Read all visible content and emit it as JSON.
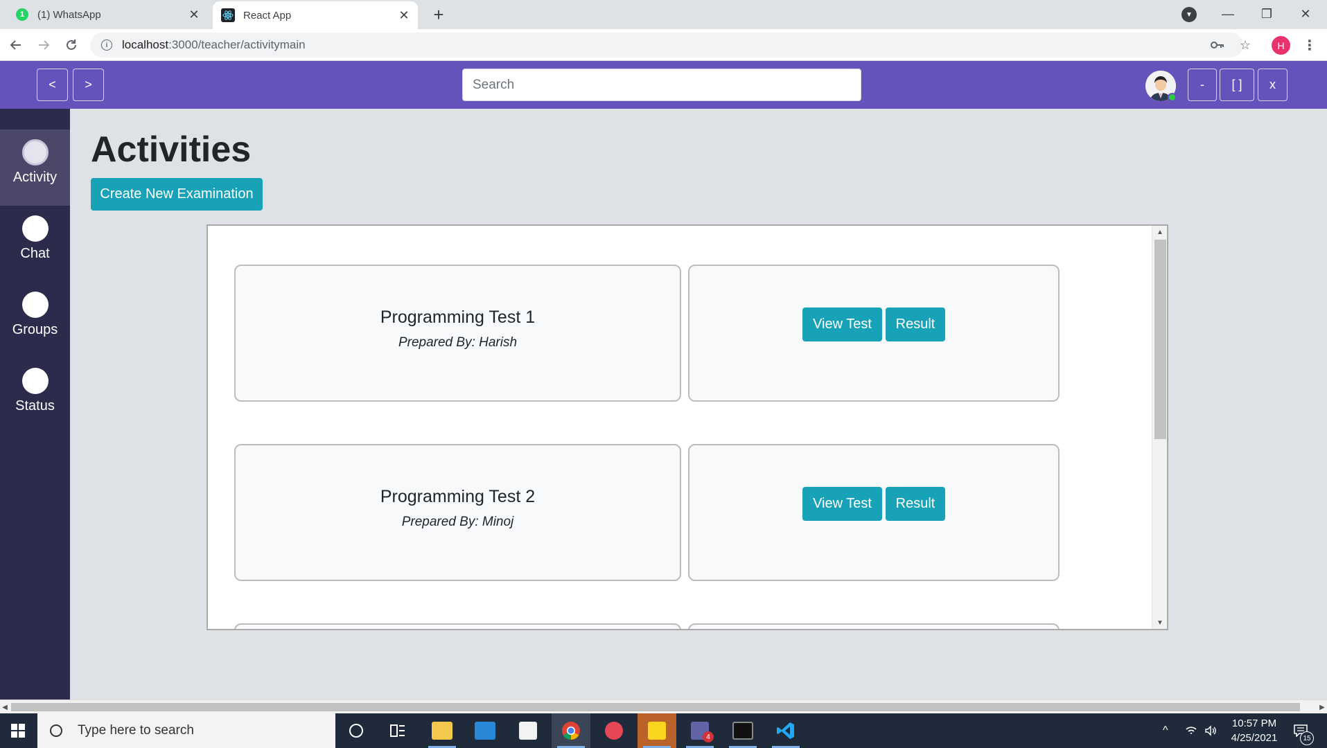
{
  "browser": {
    "tabs": [
      {
        "title": "(1) WhatsApp",
        "badge": "1"
      },
      {
        "title": "React App"
      }
    ],
    "new_tab_label": "+",
    "url_host": "localhost",
    "url_path": ":3000/teacher/activitymain",
    "profile_initial": "H",
    "window_controls": {
      "minimize": "—",
      "restore": "❐",
      "close": "✕"
    }
  },
  "header": {
    "back_label": "<",
    "forward_label": ">",
    "search_placeholder": "Search",
    "minimize_label": "-",
    "maximize_label": "[ ]",
    "close_label": "x"
  },
  "sidebar": {
    "items": [
      {
        "label": "Activity",
        "active": true
      },
      {
        "label": "Chat"
      },
      {
        "label": "Groups"
      },
      {
        "label": "Status"
      }
    ]
  },
  "main": {
    "title": "Activities",
    "create_button": "Create New Examination",
    "activities": [
      {
        "name": "Programming Test 1",
        "prepared_by": "Prepared By: Harish",
        "view_label": "View Test",
        "result_label": "Result"
      },
      {
        "name": "Programming Test 2",
        "prepared_by": "Prepared By: Minoj",
        "view_label": "View Test",
        "result_label": "Result"
      }
    ]
  },
  "taskbar": {
    "search_placeholder": "Type here to search",
    "time": "10:57 PM",
    "date": "4/25/2021",
    "teams_badge": "4",
    "notification_count": "15"
  },
  "colors": {
    "header_bg": "#6652bb",
    "sidebar_bg": "#2d2b4b",
    "accent_teal": "#17a2b8"
  }
}
